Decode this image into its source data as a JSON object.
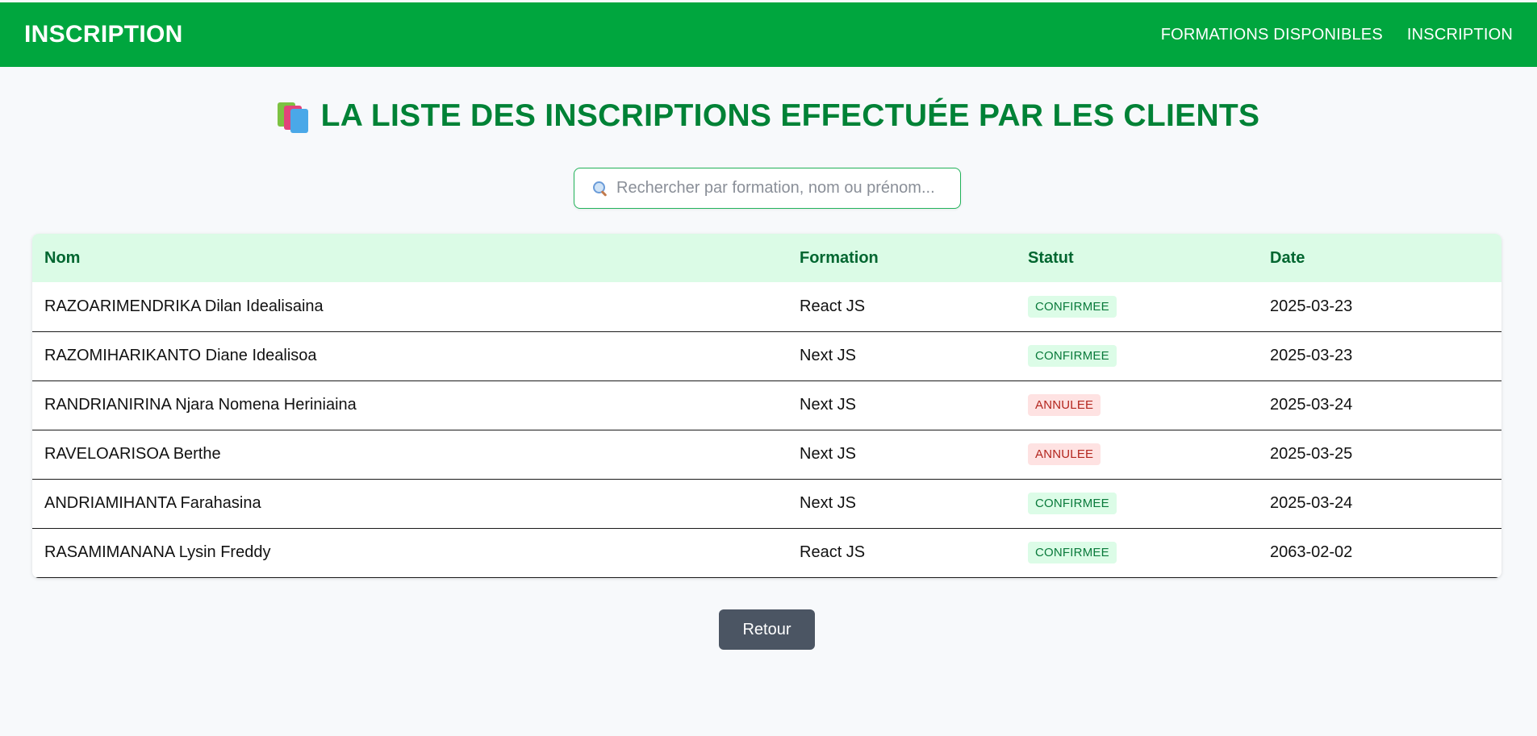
{
  "header": {
    "brand": "INSCRIPTION",
    "nav": [
      {
        "label": "FORMATIONS DISPONIBLES"
      },
      {
        "label": "INSCRIPTION"
      }
    ],
    "color": "#00a63e"
  },
  "main": {
    "title_icon": "books-icon",
    "title": "LA LISTE DES INSCRIPTIONS EFFECTUÉE PAR LES CLIENTS",
    "search": {
      "placeholder": "Rechercher par formation, nom ou prénom...",
      "value": "",
      "icon": "search-icon"
    },
    "table": {
      "columns": [
        "Nom",
        "Formation",
        "Statut",
        "Date"
      ],
      "rows": [
        {
          "nom": "RAZOARIMENDRIKA Dilan Idealisaina",
          "formation": "React JS",
          "statut": "CONFIRMEE",
          "date": "2025-03-23"
        },
        {
          "nom": "RAZOMIHARIKANTO Diane Idealisoa",
          "formation": "Next JS",
          "statut": "CONFIRMEE",
          "date": "2025-03-23"
        },
        {
          "nom": "RANDRIANIRINA Njara Nomena Heriniaina",
          "formation": "Next JS",
          "statut": "ANNULEE",
          "date": "2025-03-24"
        },
        {
          "nom": "RAVELOARISOA Berthe",
          "formation": "Next JS",
          "statut": "ANNULEE",
          "date": "2025-03-25"
        },
        {
          "nom": "ANDRIAMIHANTA Farahasina",
          "formation": "Next JS",
          "statut": "CONFIRMEE",
          "date": "2025-03-24"
        },
        {
          "nom": "RASAMIMANANA Lysin Freddy",
          "formation": "React JS",
          "statut": "CONFIRMEE",
          "date": "2063-02-02"
        }
      ]
    },
    "back_label": "Retour"
  },
  "colors": {
    "primary_green": "#00a63e",
    "title_green": "#008236",
    "confirmed_bg": "#dcfce7",
    "cancelled_bg": "#fee2e2",
    "button_gray": "#4b5563"
  }
}
